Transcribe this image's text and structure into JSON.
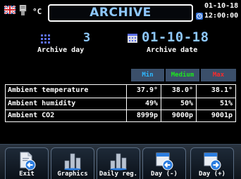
{
  "header": {
    "unit": "°C",
    "title": "ARCHIVE",
    "date": "01-10-18",
    "time": "12:00:00"
  },
  "info": {
    "archive_day_value": "3",
    "archive_day_label": "Archive day",
    "archive_date_value": "01-10-18",
    "archive_date_label": "Archive date"
  },
  "table": {
    "headers": {
      "min": "Min",
      "medium": "Medium",
      "max": "Max"
    },
    "rows": [
      {
        "label": "Ambient temperature",
        "min": "37.9°",
        "medium": "38.0°",
        "max": "38.1°"
      },
      {
        "label": "Ambient humidity",
        "min": "49%",
        "medium": "50%",
        "max": "51%"
      },
      {
        "label": "Ambient CO2",
        "min": "8999p",
        "medium": "9000p",
        "max": "9001p"
      }
    ]
  },
  "buttons": {
    "exit": "Exit",
    "graphics": "Graphics",
    "daily_reg": "Daily reg.",
    "day_minus": "Day (-)",
    "day_plus": "Day (+)"
  },
  "colors": {
    "accent_blue": "#8ec8ff",
    "min": "#2fb8ff",
    "medium": "#1ee81e",
    "max": "#ff2a2a"
  }
}
